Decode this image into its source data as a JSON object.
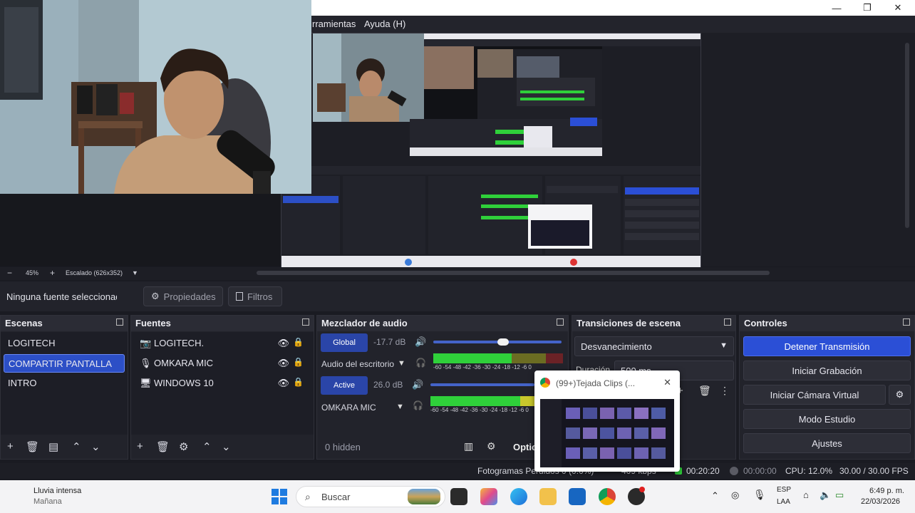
{
  "window": {
    "minimize": "—",
    "maximize": "❐",
    "close": "✕"
  },
  "menu": {
    "tools": "rramientas",
    "help": "Ayuda (H)"
  },
  "preview_toolbar": {
    "zoom_out": "−",
    "zoom": "45%",
    "zoom_in": "+",
    "scale": "Escalado (626x352)",
    "dropdown": "▼"
  },
  "source_toolbar": {
    "no_source": "Ninguna fuente seleccionad",
    "properties": "Propiedades",
    "filters": "Filtros"
  },
  "scenes": {
    "title": "Escenas",
    "items": [
      {
        "label": "LOGITECH",
        "selected": false
      },
      {
        "label": "COMPARTIR PANTALLA",
        "selected": true
      },
      {
        "label": "INTRO",
        "selected": false
      }
    ]
  },
  "sources": {
    "title": "Fuentes",
    "items": [
      {
        "label": "LOGITECH.",
        "icon": "camera-icon"
      },
      {
        "label": "OMKARA MIC",
        "icon": "microphone-icon"
      },
      {
        "label": "WINDOWS 10",
        "icon": "monitor-icon"
      }
    ]
  },
  "mixer": {
    "title": "Mezclador de audio",
    "channels": [
      {
        "badge": "Global",
        "db": "-17.7 dB",
        "name": "Audio del escritorio",
        "volume": 0.82
      },
      {
        "badge": "Active",
        "db": "26.0 dB",
        "name": "OMKARA MIC",
        "volume": 1.0
      }
    ],
    "ticks": "-60 -54 -48 -42 -36 -30 -24 -18 -12 -6 0",
    "hidden": "0 hidden",
    "options": "Optio"
  },
  "transitions": {
    "title": "Transiciones de escena",
    "type": "Desvanecimiento",
    "duration_label": "Duración",
    "duration_value": "500 ms"
  },
  "controls": {
    "title": "Controles",
    "stop_stream": "Detener Transmisión",
    "start_recording": "Iniciar Grabación",
    "start_virtual_cam": "Iniciar Cámara Virtual",
    "studio_mode": "Modo Estudio",
    "settings": "Ajustes"
  },
  "status": {
    "dropped": "Fotogramas Perdidos 0 (0.0%)",
    "bitrate": "409 kbps",
    "stream_time": "00:20:20",
    "rec_time": "00:00:00",
    "cpu": "CPU: 12.0%",
    "fps": "30.00 / 30.00 FPS"
  },
  "popup": {
    "title": "(99+)Tejada Clips (...",
    "close": "✕"
  },
  "taskbar": {
    "weather_title": "Lluvia intensa",
    "weather_sub": "Mañana",
    "search": "Buscar",
    "lang_top": "ESP",
    "lang_bottom": "LAA",
    "time": "6:49 p. m.",
    "date": "22/03/2026"
  },
  "nested_obs": {
    "menu": "Ayuda (H)",
    "scenes": [
      "COMPARTIR PANTALLA",
      "INTRO"
    ],
    "sources": [
      "LOGITECH",
      "OMKARA MIC",
      "WINDOWS 10"
    ],
    "controls": [
      "Detener Transmisión",
      "Iniciar Grabación",
      "Iniciar Cámara Virtual",
      "Modo Estudio",
      "Ajustes"
    ],
    "status": "CPU: 12.0%   30.00 / 30.00 FPS"
  },
  "colors": {
    "accent": "#2b4fd6",
    "panel": "#22232b",
    "meter_green": "#2fd03a",
    "meter_yellow": "#c9c82c",
    "meter_red": "#d2333a"
  }
}
